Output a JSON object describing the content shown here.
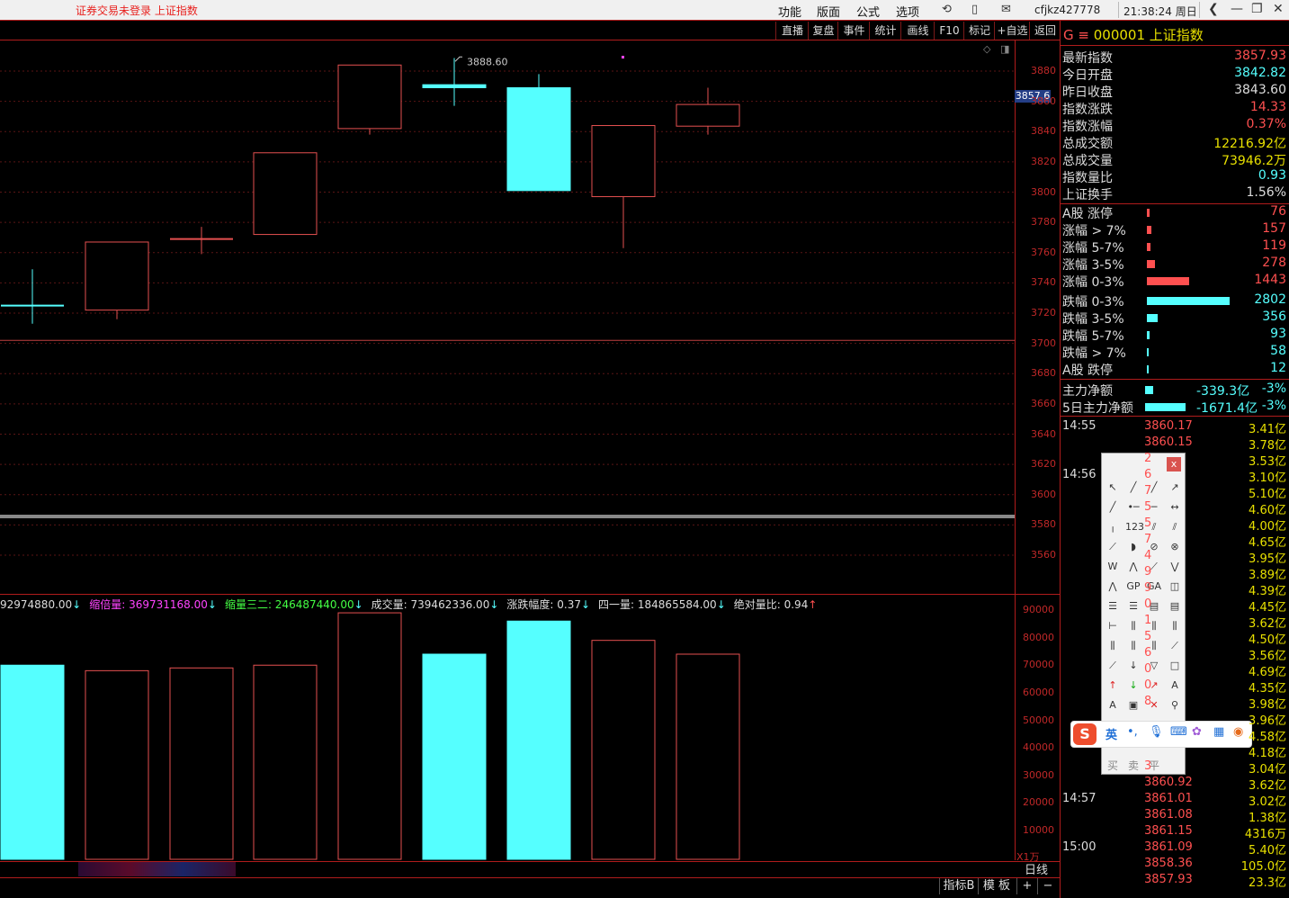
{
  "topbar": {
    "warning": "证券交易未登录  上证指数",
    "menu": [
      "功能",
      "版面",
      "公式",
      "选项"
    ],
    "user": "cfjkz427778",
    "clock": "21:38:24 周日"
  },
  "toolbar": [
    "直播",
    "复盘",
    "事件",
    "统计",
    "画线",
    "F10",
    "标记",
    "+自选",
    "返回"
  ],
  "chart": {
    "high_label": "3888.60",
    "current_price_tag": "3857.6",
    "y_ticks": [
      "3880",
      "3860",
      "3840",
      "3820",
      "3800",
      "3780",
      "3760",
      "3740",
      "3720",
      "3700",
      "3680",
      "3660",
      "3640",
      "3620",
      "3600",
      "3580",
      "3560"
    ]
  },
  "chart_data": {
    "type": "candlestick",
    "period": "日线",
    "candles": [
      {
        "o": 3725,
        "h": 3749,
        "l": 3713,
        "c": 3725,
        "dir": "down"
      },
      {
        "o": 3722,
        "h": 3767,
        "l": 3716,
        "c": 3767,
        "dir": "up"
      },
      {
        "o": 3769,
        "h": 3777,
        "l": 3759,
        "c": 3769,
        "dir": "up"
      },
      {
        "o": 3772,
        "h": 3826,
        "l": 3772,
        "c": 3826,
        "dir": "up"
      },
      {
        "o": 3842,
        "h": 3884,
        "l": 3838,
        "c": 3884,
        "dir": "up"
      },
      {
        "o": 3871,
        "h": 3888.6,
        "l": 3857,
        "c": 3869,
        "dir": "down"
      },
      {
        "o": 3869,
        "h": 3878,
        "l": 3801,
        "c": 3801,
        "dir": "down"
      },
      {
        "o": 3797,
        "h": 3844,
        "l": 3763,
        "c": 3844,
        "dir": "up"
      },
      {
        "o": 3843.6,
        "h": 3869,
        "l": 3838,
        "c": 3857.93,
        "dir": "up"
      }
    ],
    "volume": {
      "y_ticks": [
        "90000",
        "80000",
        "70000",
        "60000",
        "50000",
        "40000",
        "30000",
        "20000",
        "10000"
      ],
      "unit": "X1万",
      "values": [
        70000,
        68000,
        69000,
        70000,
        89000,
        74000,
        86000,
        79000,
        74000
      ]
    }
  },
  "indicator_line": [
    {
      "text": "92974880.00",
      "arrow": "↓",
      "color": "#dddddd"
    },
    {
      "text": "缩倍量: 369731168.00",
      "arrow": "↓",
      "color": "#ff44ff"
    },
    {
      "text": "缩量三二: 246487440.00",
      "arrow": "↓",
      "color": "#44ff44"
    },
    {
      "text": "成交量: 739462336.00",
      "arrow": "↓",
      "color": "#dddddd"
    },
    {
      "text": "涨跌幅度: 0.37",
      "arrow": "↓",
      "color": "#dddddd"
    },
    {
      "text": "四一量: 184865584.00",
      "arrow": "↓",
      "color": "#dddddd"
    },
    {
      "text": "绝对量比: 0.94",
      "arrow": "↑",
      "color": "#dddddd"
    }
  ],
  "panel": {
    "header_prefix": "G ≡",
    "code": "000001",
    "name": "上证指数",
    "stats": [
      {
        "label": "最新指数",
        "value": "3857.93",
        "color": "#ff5050"
      },
      {
        "label": "今日开盘",
        "value": "3842.82",
        "color": "#5ff"
      },
      {
        "label": "昨日收盘",
        "value": "3843.60",
        "color": "#dddddd"
      },
      {
        "label": "指数涨跌",
        "value": "14.33",
        "color": "#ff5050"
      },
      {
        "label": "指数涨幅",
        "value": "0.37%",
        "color": "#ff5050"
      },
      {
        "label": "总成交额",
        "value": "12216.92亿",
        "color": "#e8e000"
      },
      {
        "label": "总成交量",
        "value": "73946.2万",
        "color": "#e8e000"
      },
      {
        "label": "指数量比",
        "value": "0.93",
        "color": "#5ff"
      },
      {
        "label": "上证换手",
        "value": "1.56%",
        "color": "#dddddd"
      }
    ],
    "breadth_up": [
      {
        "label": "A股 涨停",
        "value": "76",
        "frac": 0.03
      },
      {
        "label": "涨幅 > 7%",
        "value": "157",
        "frac": 0.05
      },
      {
        "label": "涨幅 5-7%",
        "value": "119",
        "frac": 0.04
      },
      {
        "label": "涨幅 3-5%",
        "value": "278",
        "frac": 0.1
      },
      {
        "label": "涨幅 0-3%",
        "value": "1443",
        "frac": 0.51
      }
    ],
    "breadth_down": [
      {
        "label": "跌幅 0-3%",
        "value": "2802",
        "frac": 1.0
      },
      {
        "label": "跌幅 3-5%",
        "value": "356",
        "frac": 0.13
      },
      {
        "label": "跌幅 5-7%",
        "value": "93",
        "frac": 0.03
      },
      {
        "label": "跌幅 > 7%",
        "value": "58",
        "frac": 0.02
      },
      {
        "label": "A股 跌停",
        "value": "12",
        "frac": 0.01
      }
    ],
    "flows": [
      {
        "label": "主力净额",
        "value": "-339.3亿",
        "pct": "-3%",
        "frac": 0.15
      },
      {
        "label": "5日主力净额",
        "value": "-1671.4亿",
        "pct": "-3%",
        "frac": 0.75
      }
    ]
  },
  "ticks": [
    {
      "time": "14:55",
      "price": "3860.17",
      "vol": "3.41亿"
    },
    {
      "time": "",
      "price": "3860.15",
      "vol": "3.78亿"
    },
    {
      "time": "",
      "price": "2",
      "vol": "3.53亿"
    },
    {
      "time": "14:56",
      "price": "6",
      "vol": "3.10亿"
    },
    {
      "time": "",
      "price": "7",
      "vol": "5.10亿"
    },
    {
      "time": "",
      "price": "5",
      "vol": "4.60亿"
    },
    {
      "time": "",
      "price": "5",
      "vol": "4.00亿"
    },
    {
      "time": "",
      "price": "7",
      "vol": "4.65亿"
    },
    {
      "time": "",
      "price": "4",
      "vol": "3.95亿"
    },
    {
      "time": "",
      "price": "9",
      "vol": "3.89亿"
    },
    {
      "time": "",
      "price": "9",
      "vol": "4.39亿"
    },
    {
      "time": "",
      "price": "0",
      "vol": "4.45亿"
    },
    {
      "time": "",
      "price": "1",
      "vol": "3.62亿"
    },
    {
      "time": "",
      "price": "5",
      "vol": "4.50亿"
    },
    {
      "time": "",
      "price": "6",
      "vol": "3.56亿"
    },
    {
      "time": "",
      "price": "0",
      "vol": "4.69亿"
    },
    {
      "time": "",
      "price": "0",
      "vol": "4.35亿"
    },
    {
      "time": "",
      "price": "8",
      "vol": "3.98亿"
    },
    {
      "time": "",
      "price": "",
      "vol": "3.96亿"
    },
    {
      "time": "",
      "price": "",
      "vol": "4.58亿"
    },
    {
      "time": "",
      "price": "",
      "vol": "4.18亿"
    },
    {
      "time": "",
      "price": "3",
      "vol": "3.04亿"
    },
    {
      "time": "",
      "price": "3860.92",
      "vol": "3.62亿"
    },
    {
      "time": "14:57",
      "price": "3861.01",
      "vol": "3.02亿"
    },
    {
      "time": "",
      "price": "3861.08",
      "vol": "1.38亿"
    },
    {
      "time": "",
      "price": "3861.15",
      "vol": "4316万"
    },
    {
      "time": "15:00",
      "price": "3861.09",
      "vol": "5.40亿"
    },
    {
      "time": "",
      "price": "3858.36",
      "vol": "105.0亿"
    },
    {
      "time": "",
      "price": "3857.93",
      "vol": "23.3亿"
    }
  ],
  "palette": {
    "close": "x",
    "bottom": [
      "买",
      "卖",
      "平"
    ]
  },
  "ime": {
    "logo": "S",
    "lang": "英"
  },
  "bottom": {
    "period_tab": "日线",
    "tabs": [
      "指标B",
      "模 板"
    ],
    "plus": "+",
    "minus": "−"
  }
}
